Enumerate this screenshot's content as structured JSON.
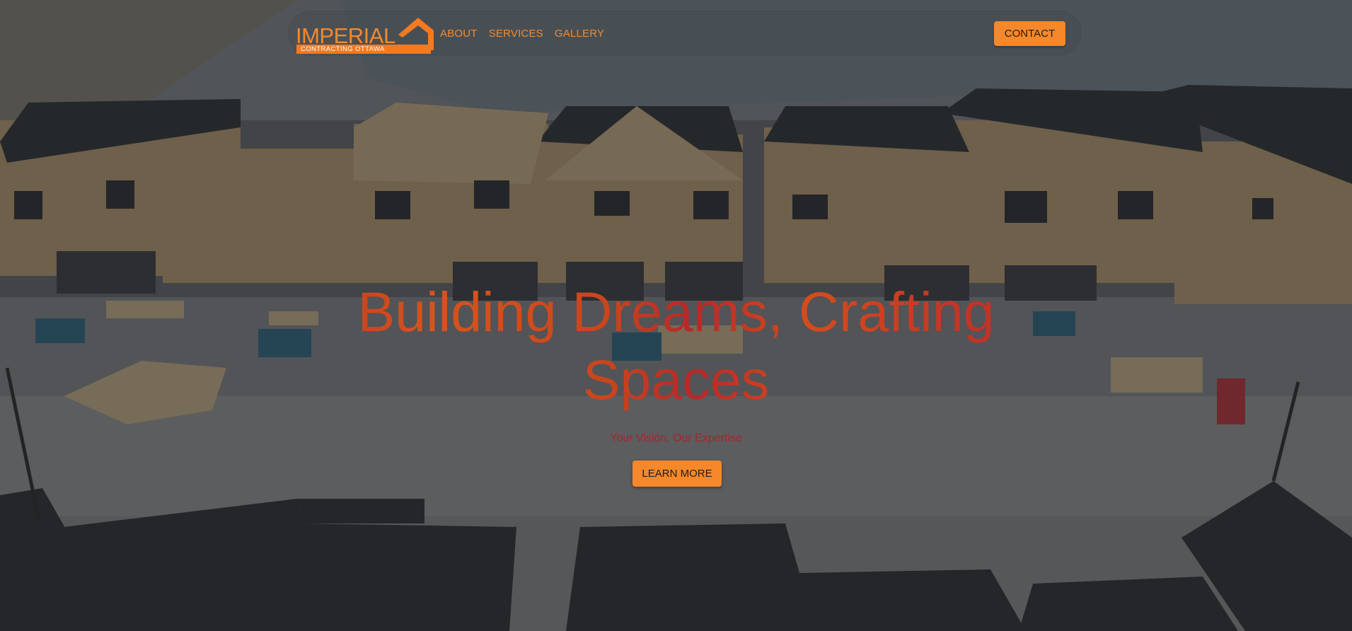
{
  "brand": {
    "logo_word": "IMPERIAL",
    "logo_subtitle": "CONTRACTING OTTAWA",
    "accent_color": "#f5882a"
  },
  "nav": {
    "links": [
      {
        "label": "ABOUT"
      },
      {
        "label": "SERVICES"
      },
      {
        "label": "GALLERY"
      }
    ],
    "contact_label": "CONTACT"
  },
  "hero": {
    "background": "aerial-view-houses-under-construction",
    "headline": "Building Dreams, Crafting Spaces",
    "tagline": "Your Vision, Our Expertise",
    "cta_label": "LEARN MORE"
  }
}
